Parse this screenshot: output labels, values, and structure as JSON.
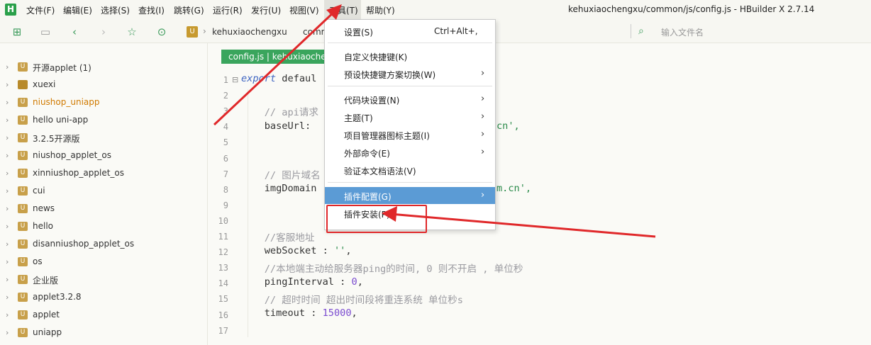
{
  "app": {
    "logo_letter": "H",
    "window_title": "kehuxiaochengxu/common/js/config.js - HBuilder X 2.7.14"
  },
  "menubar": {
    "items": [
      "文件(F)",
      "编辑(E)",
      "选择(S)",
      "查找(I)",
      "跳转(G)",
      "运行(R)",
      "发行(U)",
      "视图(V)",
      "工具(T)",
      "帮助(Y)"
    ],
    "active_index": 8
  },
  "toolbar": {
    "breadcrumb_project": "kehuxiaochengxu",
    "breadcrumb_next": "comm",
    "file_search_placeholder": "输入文件名",
    "icons": [
      "new-file-icon",
      "save-icon",
      "back-icon",
      "forward-icon",
      "favorite-icon",
      "run-icon"
    ]
  },
  "sidebar": {
    "items": [
      {
        "label": "开源applet (1)",
        "icon": "U",
        "highlight": false
      },
      {
        "label": "xuexi",
        "icon": "folder",
        "highlight": false
      },
      {
        "label": "niushop_uniapp",
        "icon": "U",
        "highlight": true
      },
      {
        "label": "hello uni-app",
        "icon": "U",
        "highlight": false
      },
      {
        "label": "3.2.5开源版",
        "icon": "U",
        "highlight": false
      },
      {
        "label": "niushop_applet_os",
        "icon": "U",
        "highlight": false
      },
      {
        "label": "xinniushop_applet_os",
        "icon": "U",
        "highlight": false
      },
      {
        "label": "cui",
        "icon": "U",
        "highlight": false
      },
      {
        "label": "news",
        "icon": "U",
        "highlight": false
      },
      {
        "label": "hello",
        "icon": "U",
        "highlight": false
      },
      {
        "label": "disanniushop_applet_os",
        "icon": "U",
        "highlight": false
      },
      {
        "label": "os",
        "icon": "U",
        "highlight": false
      },
      {
        "label": "企业版",
        "icon": "U",
        "highlight": false
      },
      {
        "label": "applet3.2.8",
        "icon": "U",
        "highlight": false
      },
      {
        "label": "applet",
        "icon": "U",
        "highlight": false
      },
      {
        "label": "uniapp",
        "icon": "U",
        "highlight": false
      }
    ]
  },
  "editor": {
    "tab_label": "config.js | kehuxiaochengxu/common/js",
    "line_numbers": [
      "1",
      "2",
      "3",
      "4",
      "5",
      "6",
      "7",
      "8",
      "9",
      "10",
      "11",
      "12",
      "13",
      "14",
      "15",
      "16",
      "17"
    ],
    "lines": {
      "l1_keyword": "export",
      "l1_rest": " defaul",
      "l3": "    // api请求",
      "l4_a": "    baseUrl:",
      "l4_b": "cn',",
      "l7": "    // 图片域名",
      "l8_a": "    imgDomain",
      "l8_b": "m.cn',",
      "l11": "    //客服地址",
      "l12_a": "    webSocket : ",
      "l12_b": "''",
      "l12_c": ",",
      "l13": "    //本地端主动给服务器ping的时间, 0 则不开启 , 单位秒",
      "l14_a": "    pingInterval : ",
      "l14_b": "0",
      "l14_c": ",",
      "l15": "    // 超时时间 超出时间段将重连系统 单位秒s",
      "l16_a": "    timeout : ",
      "l16_b": "15000",
      "l16_c": ","
    }
  },
  "dropdown": {
    "items": [
      {
        "label": "设置(S)",
        "shortcut": "Ctrl+Alt+,",
        "submenu": false,
        "selected": false
      },
      {
        "label": "自定义快捷键(K)",
        "shortcut": "",
        "submenu": false,
        "selected": false
      },
      {
        "label": "预设快捷键方案切换(W)",
        "shortcut": "",
        "submenu": true,
        "selected": false
      },
      {
        "label": "代码块设置(N)",
        "shortcut": "",
        "submenu": true,
        "selected": false
      },
      {
        "label": "主题(T)",
        "shortcut": "",
        "submenu": true,
        "selected": false
      },
      {
        "label": "项目管理器图标主题(I)",
        "shortcut": "",
        "submenu": true,
        "selected": false
      },
      {
        "label": "外部命令(E)",
        "shortcut": "",
        "submenu": true,
        "selected": false
      },
      {
        "label": "验证本文档语法(V)",
        "shortcut": "",
        "submenu": false,
        "selected": false
      },
      {
        "label": "插件配置(G)",
        "shortcut": "",
        "submenu": true,
        "selected": true
      },
      {
        "label": "插件安装(P)",
        "shortcut": "",
        "submenu": false,
        "selected": false
      }
    ]
  },
  "colors": {
    "accent_green": "#3aa55d",
    "selection_blue": "#5b9bd5",
    "annotation_red": "#e0282a"
  }
}
